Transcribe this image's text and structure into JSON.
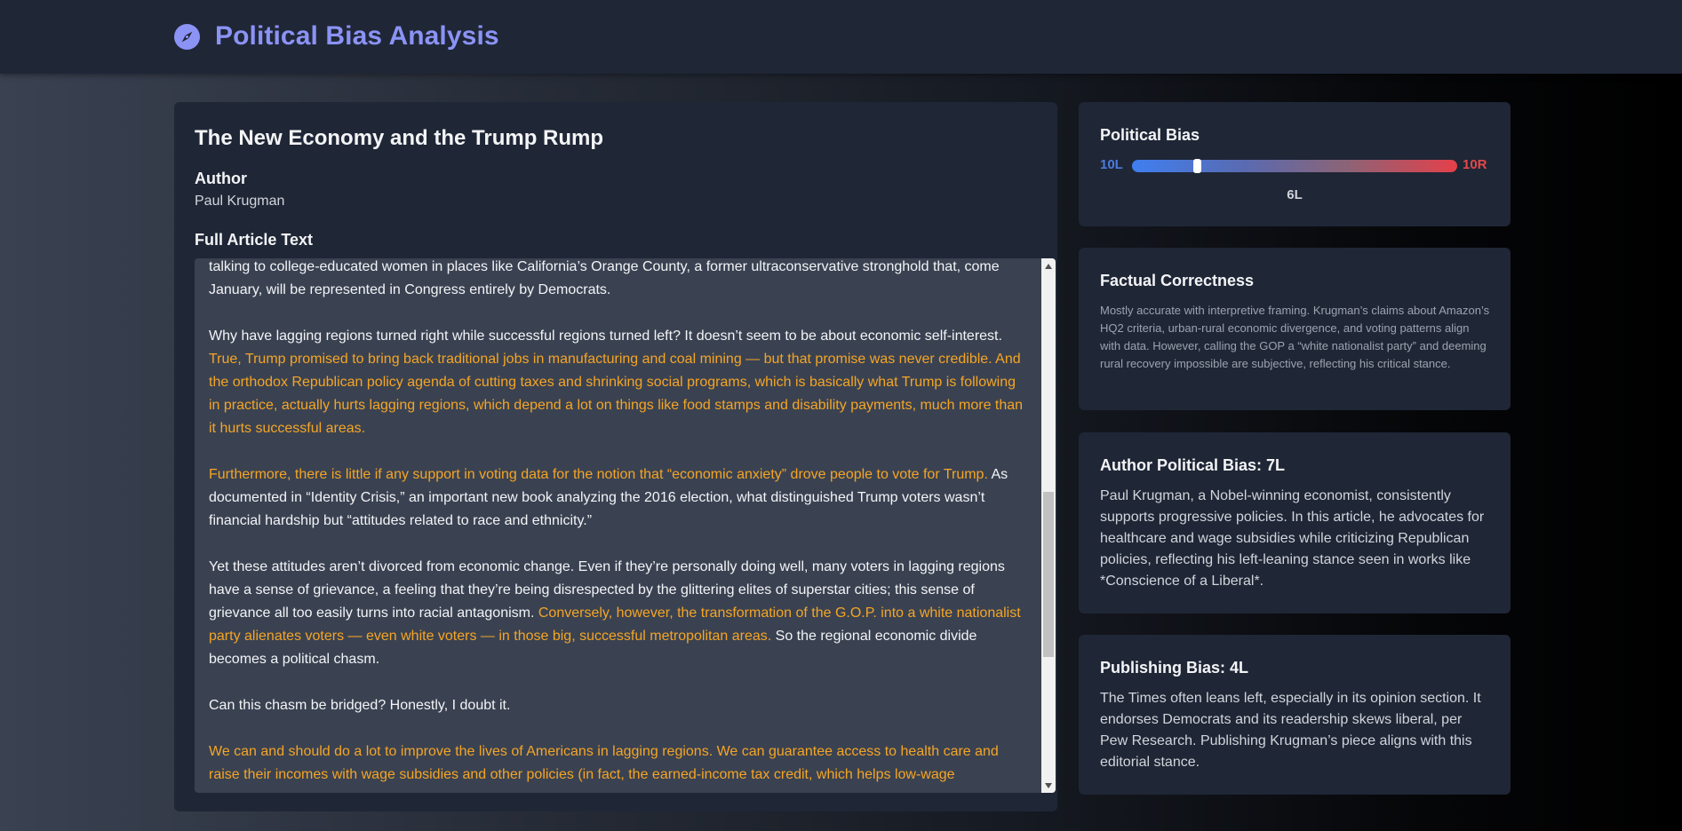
{
  "header": {
    "title": "Political Bias Analysis",
    "icon": "compass-icon",
    "accent_color": "#8b93f5"
  },
  "article": {
    "title": "The New Economy and the Trump Rump",
    "author_label": "Author",
    "author": "Paul Krugman",
    "full_text_label": "Full Article Text",
    "paragraphs": [
      [
        {
          "text": "talking to college-educated women in places like California’s Orange County, a former ultraconservative stronghold that, come January, will be represented in Congress entirely by Democrats.",
          "hl": false
        }
      ],
      [
        {
          "text": "Why have lagging regions turned right while successful regions turned left? It doesn’t seem to be about economic self-interest. ",
          "hl": false
        },
        {
          "text": "True, Trump promised to bring back traditional jobs in manufacturing and coal mining — but that promise was never credible. And the orthodox Republican policy agenda of cutting taxes and shrinking social programs, which is basically what Trump is following in practice, actually hurts lagging regions, which depend a lot on things like food stamps and disability payments, much more than it hurts successful areas.",
          "hl": true
        }
      ],
      [
        {
          "text": "Furthermore, there is little if any support in voting data for the notion that “economic anxiety” drove people to vote for Trump.",
          "hl": true
        },
        {
          "text": " As documented in “Identity Crisis,” an important new book analyzing the 2016 election, what distinguished Trump voters wasn’t financial hardship but “attitudes related to race and ethnicity.”",
          "hl": false
        }
      ],
      [
        {
          "text": "Yet these attitudes aren’t divorced from economic change. Even if they’re personally doing well, many voters in lagging regions have a sense of grievance, a feeling that they’re being disrespected by the glittering elites of superstar cities; this sense of grievance all too easily turns into racial antagonism. ",
          "hl": false
        },
        {
          "text": "Conversely, however, the transformation of the G.O.P. into a white nationalist party alienates voters — even white voters — in those big, successful metropolitan areas.",
          "hl": true
        },
        {
          "text": " So the regional economic divide becomes a political chasm.",
          "hl": false
        }
      ],
      [
        {
          "text": "Can this chasm be bridged? Honestly, I doubt it.",
          "hl": false
        }
      ],
      [
        {
          "text": "We can and should do a lot to improve the lives of Americans in lagging regions. We can guarantee access to health care and raise their incomes with wage subsidies and other policies (in fact, the earned-income tax credit, which helps low-wage",
          "hl": true
        }
      ]
    ],
    "highlight_color": "#f5a524"
  },
  "political_bias": {
    "title": "Political Bias",
    "left_label": "10L",
    "right_label": "10R",
    "value_label": "6L",
    "position_fraction": 0.2,
    "left_color": "#3f7ff0",
    "right_color": "#e5404a"
  },
  "factual": {
    "title": "Factual Correctness",
    "body": "Mostly accurate with interpretive framing. Krugman’s claims about Amazon’s HQ2 criteria, urban-rural economic divergence, and voting patterns align with data. However, calling the GOP a “white nationalist party” and deeming rural recovery impossible are subjective, reflecting his critical stance."
  },
  "author_bias": {
    "title": "Author Political Bias: 7L",
    "body": "Paul Krugman, a Nobel-winning economist, consistently supports progressive policies. In this article, he advocates for healthcare and wage subsidies while criticizing Republican policies, reflecting his left-leaning stance seen in works like *Conscience of a Liberal*."
  },
  "publishing_bias": {
    "title": "Publishing Bias: 4L",
    "body": "The Times often leans left, especially in its opinion section. It endorses Democrats and its readership skews liberal, per Pew Research. Publishing Krugman’s piece aligns with this editorial stance."
  }
}
